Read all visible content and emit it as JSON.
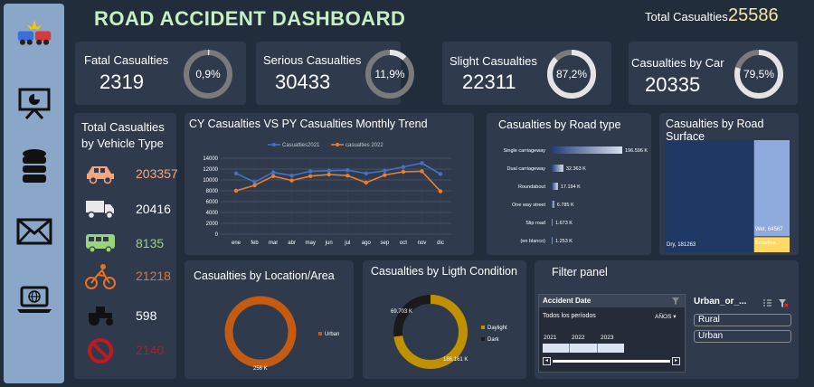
{
  "header": {
    "title": "ROAD ACCIDENT DASHBOARD",
    "total_label": "Total Casualties",
    "total_value": "25586"
  },
  "sidebar": {
    "icons": [
      "car-crash-icon",
      "presentation-icon",
      "database-icon",
      "mail-icon",
      "laptop-globe-icon"
    ]
  },
  "kpis": [
    {
      "label": "Fatal Casualties",
      "value": "2319",
      "pct": "0,9%",
      "fraction": 0.009
    },
    {
      "label": "Serious Casualties",
      "value": "30433",
      "pct": "11,9%",
      "fraction": 0.119
    },
    {
      "label": "Slight Casualties",
      "value": "22311",
      "pct": "87,2%",
      "fraction": 0.872
    },
    {
      "label": "Casualties by Car",
      "value": "20335",
      "pct": "79,5%",
      "fraction": 0.795
    }
  ],
  "vehicle_type": {
    "title_line1": "Total Casualties",
    "title_line2": "by Vehicle Type",
    "items": [
      {
        "icon": "car-icon",
        "value": "203357",
        "color": "#f4a582"
      },
      {
        "icon": "truck-icon",
        "value": "20416",
        "color": "#ffffff"
      },
      {
        "icon": "bus-icon",
        "value": "8135",
        "color": "#9bd27c"
      },
      {
        "icon": "bicycle-icon",
        "value": "21218",
        "color": "#e8712a"
      },
      {
        "icon": "tractor-icon",
        "value": "598",
        "color": "#ffffff"
      },
      {
        "icon": "no-entry-icon",
        "value": "2140",
        "color": "#c0191e"
      }
    ]
  },
  "trend": {
    "title": "CY Casualties VS PY Casualties Monthly Trend",
    "legend_cy": "Casualties2021",
    "legend_py": "casualties 2022",
    "y_ticks": [
      "14000",
      "12000",
      "10000",
      "8000",
      "6000",
      "4000",
      "2000",
      "0"
    ]
  },
  "road_type": {
    "title": "Casualties by Road type",
    "colors": {
      "bar": "#2b4a8a",
      "bar_end": "#cfd8ea"
    }
  },
  "road_surface": {
    "title": "Casualties by Road Surface",
    "dry_label": "Dry, 181263",
    "wet_label": "Wet, 64567",
    "snow_label": "Snow/Ice..."
  },
  "location": {
    "title": "Casualties by Location/Area",
    "legend": "Urban",
    "value_label": "256 K"
  },
  "light": {
    "title": "Casualties by Ligth Condition",
    "legend_daylight": "Daylight",
    "legend_dark": "Dark",
    "dark_label": "69.703 K",
    "day_label": "186.161 K"
  },
  "filter": {
    "title": "Filter panel",
    "date_title": "Accident Date",
    "all_periods": "Todos los períodos",
    "years_label": "AÑOS",
    "years": [
      "2021",
      "2022",
      "2023"
    ],
    "slicer_title": "Urban_or_...",
    "options": [
      "Rural",
      "Urban"
    ]
  },
  "chart_data": [
    {
      "type": "line",
      "title": "CY Casualties VS PY Casualties Monthly Trend",
      "categories": [
        "ene",
        "feb",
        "mar",
        "abr",
        "may",
        "jun",
        "jul",
        "ago",
        "sep",
        "oct",
        "nov",
        "dic"
      ],
      "ylim": [
        0,
        14000
      ],
      "series": [
        {
          "name": "Casualties2021",
          "color": "#4472c4",
          "values": [
            11200,
            9600,
            11400,
            10800,
            11600,
            11700,
            11800,
            11200,
            11700,
            12400,
            13100,
            11100
          ]
        },
        {
          "name": "casualties 2022",
          "color": "#ed7d31",
          "values": [
            8000,
            9000,
            10700,
            9900,
            10700,
            11000,
            10800,
            9500,
            10900,
            11500,
            11600,
            7900
          ]
        }
      ]
    },
    {
      "type": "bar",
      "title": "Casualties by Road type",
      "categories": [
        "Single carriageway",
        "Dual carriageway",
        "Roundabout",
        "One way street",
        "Slip road",
        "(en blanco)"
      ],
      "values": [
        196.596,
        32.363,
        17.194,
        6.785,
        1.673,
        1.253
      ],
      "labels": [
        "196.596 K",
        "32.363 K",
        "17.194 K",
        "6.785 K",
        "1.673 K",
        "1.253 K"
      ]
    },
    {
      "type": "bar",
      "title": "Casualties by Road Surface",
      "categories": [
        "Dry",
        "Wet",
        "Snow/Ice"
      ],
      "values": [
        181263,
        64567,
        10034
      ],
      "colors": [
        "#1f3864",
        "#8faadc",
        "#ffd966"
      ]
    },
    {
      "type": "pie",
      "title": "Casualties by Location/Area",
      "categories": [
        "Urban"
      ],
      "values": [
        256
      ],
      "colors": [
        "#c55a11"
      ]
    },
    {
      "type": "pie",
      "title": "Casualties by Ligth Condition",
      "categories": [
        "Daylight",
        "Dark"
      ],
      "values": [
        186.161,
        69.703
      ],
      "colors": [
        "#bf9000",
        "#1a1a1a"
      ]
    }
  ]
}
